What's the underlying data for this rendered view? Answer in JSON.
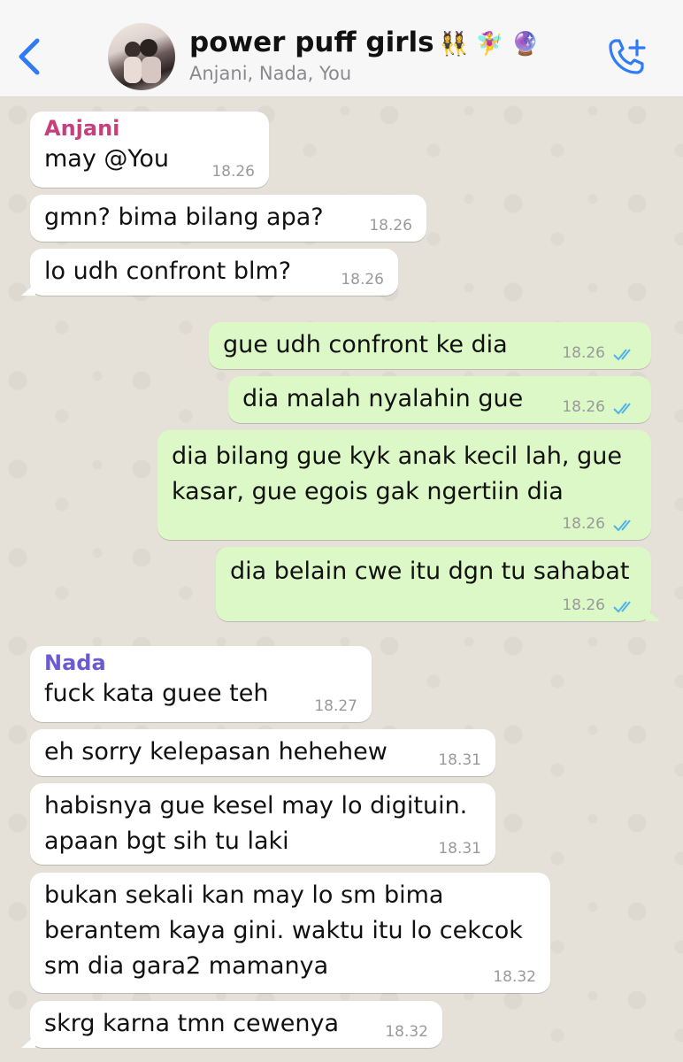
{
  "header": {
    "title": "power puff girls",
    "title_emojis": "👯‍♀️ 🧚‍♀️ 🔮",
    "subtitle": "Anjani, Nada, You"
  },
  "colors": {
    "anjani": "#c6407e",
    "nada": "#6b5bd1",
    "accent": "#2f7cf6",
    "tick": "#4fb3ea"
  },
  "messages": [
    {
      "sender": "Anjani",
      "text": "may @You",
      "time": "18.26"
    },
    {
      "text": "gmn? bima bilang apa?",
      "time": "18.26"
    },
    {
      "text": "lo udh confront blm?",
      "time": "18.26"
    },
    {
      "text": "gue udh confront ke dia",
      "time": "18.26"
    },
    {
      "text": "dia malah nyalahin gue",
      "time": "18.26"
    },
    {
      "text": "dia bilang gue kyk anak kecil lah, gue\nkasar, gue egois gak ngertiin dia",
      "time": "18.26"
    },
    {
      "text": "dia belain cwe itu dgn tu sahabat",
      "time": "18.26"
    },
    {
      "sender": "Nada",
      "text": "fuck kata guee teh",
      "time": "18.27"
    },
    {
      "text": "eh sorry kelepasan hehehew",
      "time": "18.31"
    },
    {
      "text": "habisnya gue kesel may lo digituin.\napaan bgt sih tu laki",
      "time": "18.31"
    },
    {
      "text": "bukan sekali kan may lo sm bima\nberantem kaya gini. waktu itu lo cekcok\nsm dia gara2 mamanya",
      "time": "18.32"
    },
    {
      "text": "skrg karna tmn cewenya",
      "time": "18.32"
    }
  ]
}
